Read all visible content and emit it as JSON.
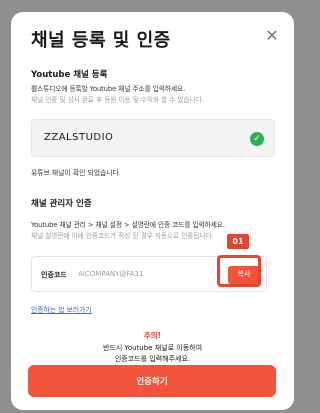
{
  "modal": {
    "title": "채널 등록 및 인증",
    "close_glyph": "✕"
  },
  "youtube_section": {
    "title": "Youtube 채널 등록",
    "desc_line1": "펠스튜디오에 등록할 Youtube 채널 주소를 입력하세요.",
    "desc_line2": "채널 인증 및 심사 완료 후 등원 이용 및 수익화 할 수 있습니다.",
    "input_value": "ZZALSTUDIO",
    "check_glyph": "✓",
    "confirm_text": "유튜브 채널이 확인 되었습니다."
  },
  "verify_section": {
    "title": "채널 관리자 인증",
    "desc_line1": "Youtube 채널 관리 > 채널 설정 > 설명란에 인증 코드를 입력하세요.",
    "desc_line2": "채널 설명란에 아래 인증코드가 작성 된 경우 자동으로 인증됩니다.",
    "code_label": "인증코드",
    "code_value": "AICOMPANY@FA31",
    "copy_label": "복사",
    "badge": "01",
    "link_text": "인증하는 법 보러가기"
  },
  "warning": {
    "title": "주의!",
    "line1": "반드시 Youtube 채널로 이동하여",
    "line2": "인증코드를 입력해주세요."
  },
  "cta": {
    "label": "인증하기"
  },
  "colors": {
    "accent": "#f2533a",
    "highlight": "#e8432c",
    "success": "#27b34a",
    "link": "#3a6bd6"
  }
}
